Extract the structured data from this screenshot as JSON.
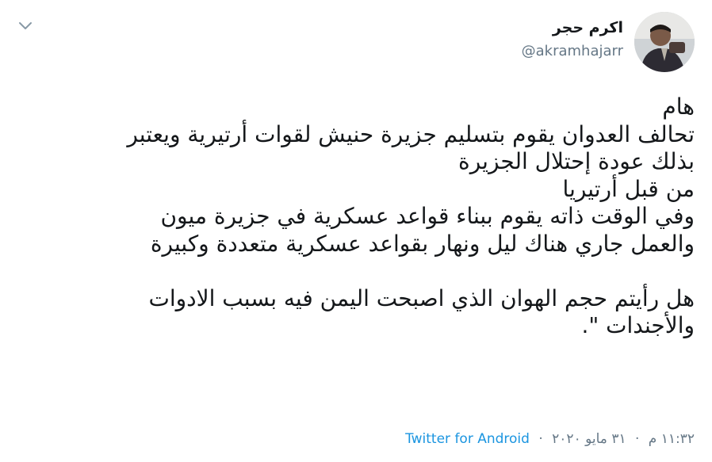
{
  "author": {
    "name": "اكرم حجر",
    "handle": "@akramhajarr",
    "avatar_icon": "profile-photo"
  },
  "menu": {
    "icon": "chevron-down-icon"
  },
  "tweet": {
    "lines": [
      "هام",
      "تحالف العدوان يقوم بتسليم جزيرة حنيش لقوات أرتيرية ويعتبر",
      "بذلك عودة إحتلال الجزيرة",
      "من قبل أرتيريا",
      "وفي الوقت ذاته يقوم ببناء قواعد عسكرية في جزيرة ميون",
      "والعمل جاري هناك ليل ونهار بقواعد عسكرية متعددة وكبيرة",
      "",
      "هل رأيتم حجم الهوان الذي اصبحت اليمن فيه بسبب الادوات",
      "والأجندات \"."
    ]
  },
  "meta": {
    "time": "١١:٣٢ م",
    "date": "٣١ مايو ٢٠٢٠",
    "separator": "·",
    "source": "Twitter for Android"
  },
  "colors": {
    "text": "#14171a",
    "secondary": "#657786",
    "link": "#1b95e0",
    "background": "#ffffff"
  }
}
